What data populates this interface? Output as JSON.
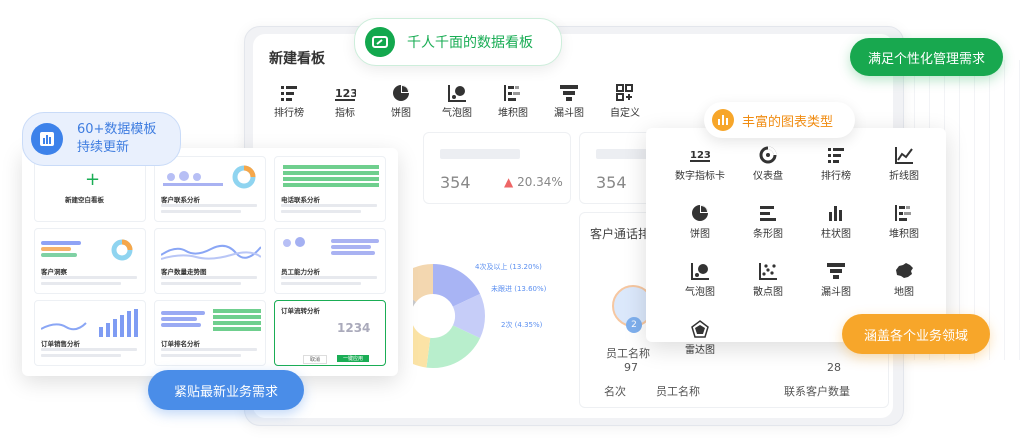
{
  "header_badge": {
    "text": "千人千面的数据看板"
  },
  "callouts": {
    "templates": {
      "line1": "60+数据模板",
      "line2": "持续更新"
    },
    "personal": "满足个性化管理需求",
    "chart_types": "丰富的图表类型",
    "coverage": "涵盖各个业务领域",
    "latest": "紧贴最新业务需求"
  },
  "board": {
    "title": "新建看板",
    "toolbar": [
      {
        "label": "排行榜",
        "icon": "rank-list-icon"
      },
      {
        "label": "指标",
        "icon": "indicator-123-icon"
      },
      {
        "label": "饼图",
        "icon": "pie-chart-icon"
      },
      {
        "label": "气泡图",
        "icon": "bubble-chart-icon"
      },
      {
        "label": "堆积图",
        "icon": "stacked-chart-icon"
      },
      {
        "label": "漏斗图",
        "icon": "funnel-chart-icon"
      },
      {
        "label": "自定义",
        "icon": "custom-grid-icon"
      }
    ],
    "kpis": [
      {
        "value": "354"
      },
      {
        "value": "20.34%"
      },
      {
        "value": "354"
      }
    ],
    "donut_labels": [
      "4次及以上 (13.20%)",
      "未跟进 (13.60%)",
      "2次 (4.35%)"
    ],
    "call_panel": {
      "title": "客户通话排",
      "employee_label": "员工名称",
      "count": "97",
      "col_rank": "名次",
      "col_name": "员工名称",
      "col_contacts": "联系客户数量",
      "number_right": "28",
      "rank_badge": "2"
    }
  },
  "templates": [
    {
      "title": "新建空白看板"
    },
    {
      "title": "客户联系分析"
    },
    {
      "title": "电话联系分析"
    },
    {
      "title": "客户洞察"
    },
    {
      "title": "客户数量走势图"
    },
    {
      "title": "员工能力分析"
    },
    {
      "title": "订单销售分析"
    },
    {
      "title": "订单排名分析"
    },
    {
      "title": "订单流转分析",
      "number": "1234",
      "buttons": [
        "取消",
        "一键应用"
      ]
    }
  ],
  "chart_menu": [
    {
      "label": "数字指标卡",
      "icon": "number-card-icon"
    },
    {
      "label": "仪表盘",
      "icon": "gauge-icon"
    },
    {
      "label": "排行榜",
      "icon": "rank-list-icon"
    },
    {
      "label": "折线图",
      "icon": "line-chart-icon"
    },
    {
      "label": "饼图",
      "icon": "pie-chart-icon"
    },
    {
      "label": "条形图",
      "icon": "bar-horizontal-icon"
    },
    {
      "label": "柱状图",
      "icon": "column-chart-icon"
    },
    {
      "label": "堆积图",
      "icon": "stacked-chart-icon"
    },
    {
      "label": "气泡图",
      "icon": "bubble-chart-icon"
    },
    {
      "label": "散点图",
      "icon": "scatter-chart-icon"
    },
    {
      "label": "漏斗图",
      "icon": "funnel-chart-icon"
    },
    {
      "label": "地图",
      "icon": "map-china-icon"
    },
    {
      "label": "雷达图",
      "icon": "radar-chart-icon"
    }
  ],
  "colors": {
    "green": "#13a84e",
    "orange": "#f7a62a",
    "blue": "#4a8de8",
    "donut": [
      "#a8b4f4",
      "#c6cdf8",
      "#b8eecc",
      "#fbe3a6",
      "#c8c9cc",
      "#f3d7b0"
    ]
  }
}
